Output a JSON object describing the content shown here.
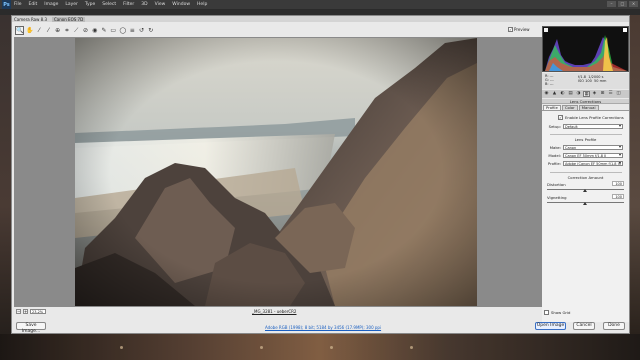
{
  "menubar": {
    "logo": "Ps",
    "items": [
      "File",
      "Edit",
      "Image",
      "Layer",
      "Type",
      "Select",
      "Filter",
      "3D",
      "View",
      "Window",
      "Help"
    ]
  },
  "dialog": {
    "title": "Camera Raw 8.3",
    "camera": "Canon EOS 7D"
  },
  "toolbar": {
    "tools": [
      {
        "name": "zoom-tool",
        "glyph": "🔍"
      },
      {
        "name": "hand-tool",
        "glyph": "✋"
      },
      {
        "name": "white-balance-tool",
        "glyph": "⁄"
      },
      {
        "name": "color-sampler-tool",
        "glyph": "⁄"
      },
      {
        "name": "targeted-adjustment-tool",
        "glyph": "⊕"
      },
      {
        "name": "crop-tool",
        "glyph": "⌗"
      },
      {
        "name": "straighten-tool",
        "glyph": "⟋"
      },
      {
        "name": "spot-removal-tool",
        "glyph": "⊘"
      },
      {
        "name": "red-eye-tool",
        "glyph": "◉"
      },
      {
        "name": "adjustment-brush-tool",
        "glyph": "✎"
      },
      {
        "name": "graduated-filter-tool",
        "glyph": "▭"
      },
      {
        "name": "radial-filter-tool",
        "glyph": "◯"
      },
      {
        "name": "preferences-tool",
        "glyph": "≡"
      },
      {
        "name": "rotate-ccw-tool",
        "glyph": "↺"
      },
      {
        "name": "rotate-cw-tool",
        "glyph": "↻"
      }
    ],
    "preview_label": "Preview",
    "preview_checked": "✓"
  },
  "zoom": {
    "minus": "−",
    "plus": "+",
    "level": "23.2%"
  },
  "filename": "_MG_3281 - ueberCR2",
  "footer": {
    "save_label": "Save Image...",
    "info": "Adobe RGB (1998); 8 bit; 5184 by 3456 (17.9MP); 300 ppi",
    "open_label": "Open Image",
    "cancel_label": "Cancel",
    "done_label": "Done"
  },
  "cam_info": {
    "r": "R:  ---",
    "g": "G:  ---",
    "b": "B:  ---",
    "aperture": "f/1.8",
    "shutter": "1/2000 s",
    "iso": "ISO 100",
    "focal": "50 mm"
  },
  "panel": {
    "icons": [
      "◉",
      "▲",
      "◐",
      "▤",
      "◑",
      "▦",
      "◈",
      "⊞",
      "☰",
      "◫"
    ],
    "title": "Lens Corrections",
    "tabs": [
      "Profile",
      "Color",
      "Manual"
    ],
    "enable_label": "Enable Lens Profile Corrections",
    "enable_checked": "✓",
    "setup_label": "Setup:",
    "setup_value": "Default",
    "lens_profile_heading": "Lens Profile",
    "make_label": "Make:",
    "make_value": "Canon",
    "model_label": "Model:",
    "model_value": "Canon EF 50mm f/1.8 II",
    "profile_label": "Profile:",
    "profile_value": "Adobe (Canon EF 50mm f/1.8 II)",
    "correction_heading": "Correction Amount",
    "distortion_label": "Distortion",
    "distortion_value": "100",
    "vignetting_label": "Vignetting",
    "vignetting_value": "100",
    "show_grid_label": "Show Grid"
  },
  "colors": {
    "accent": "#1a5fc1",
    "photo_sky": "#cfd3cf",
    "photo_rock": "#5a4a42"
  }
}
